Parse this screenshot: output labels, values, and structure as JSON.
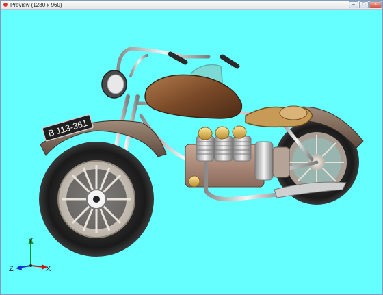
{
  "window": {
    "title": "Preview (1280 x 960)",
    "buttons": {
      "minimize": "–",
      "maximize": "□",
      "close": "×"
    }
  },
  "viewport": {
    "background": "#66ffff",
    "license_plate": "B 113-361",
    "axis_gizmo": {
      "x_label": "X",
      "y_label": "Y",
      "z_label": "Z"
    }
  }
}
